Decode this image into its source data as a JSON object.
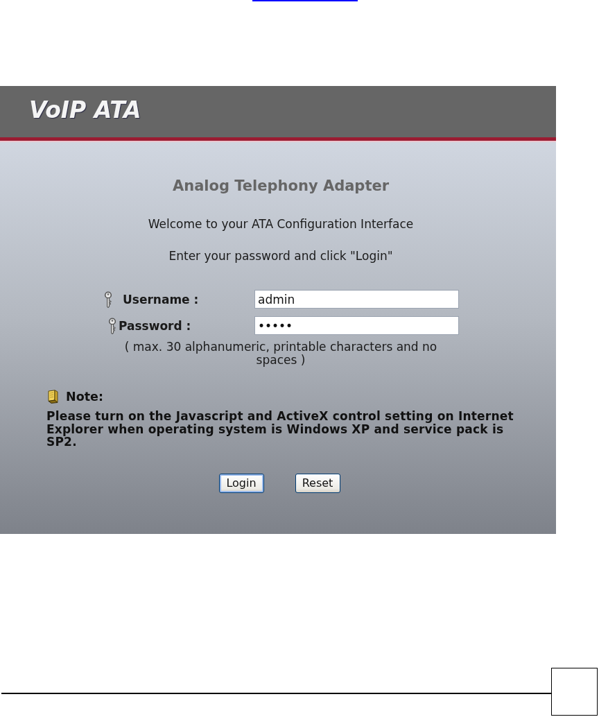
{
  "app": {
    "logo": "VoIP ATA",
    "title": "Analog Telephony Adapter",
    "welcome": "Welcome to your ATA Configuration Interface",
    "instruction": "Enter your password and click \"Login\""
  },
  "form": {
    "fields": [
      {
        "label": "Username :",
        "kind": "text",
        "value": "admin"
      },
      {
        "label": "Password :",
        "kind": "password",
        "value": "•••••"
      }
    ],
    "hint": "( max. 30 alphanumeric, printable characters and no spaces )"
  },
  "note": {
    "label": "Note:",
    "text": "Please turn on the Javascript and ActiveX control setting on Internet Explorer when operating system is Windows XP and service pack is SP2."
  },
  "buttons": [
    {
      "label": "Login",
      "focused": true
    },
    {
      "label": "Reset",
      "focused": false
    }
  ]
}
